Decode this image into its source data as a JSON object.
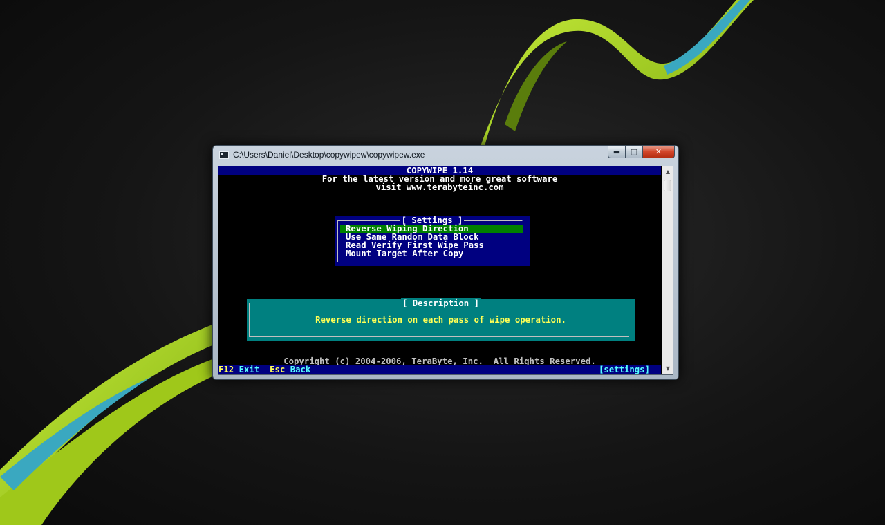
{
  "window": {
    "title": "C:\\Users\\Daniel\\Desktop\\copywipew\\copywipew.exe",
    "minimize_glyph": "▬",
    "maximize_glyph": "□",
    "close_glyph": "✕"
  },
  "console": {
    "header_title": "COPYWIPE 1.14",
    "header_line2": "For the latest version and more great software",
    "header_line3": "visit www.terabyteinc.com",
    "settings": {
      "title": "[ Settings ]",
      "items": [
        {
          "label": "Reverse Wiping Direction",
          "selected": true
        },
        {
          "label": "Use Same Random Data Block",
          "selected": false
        },
        {
          "label": "Read Verify First Wipe Pass",
          "selected": false
        },
        {
          "label": "Mount Target After Copy",
          "selected": false
        }
      ]
    },
    "description": {
      "title": "[ Description ]",
      "text": "Reverse direction on each pass of wipe operation."
    },
    "copyright": "Copyright (c) 2004-2006, TeraByte, Inc.  All Rights Reserved.",
    "footer": {
      "f12_key": "F12",
      "f12_label": "Exit",
      "esc_key": "Esc",
      "esc_label": "Back",
      "context": "[settings]"
    }
  },
  "colors": {
    "console_blue": "#000080",
    "selection_green": "#008000",
    "description_teal": "#008080",
    "highlight_yellow": "#ffff55",
    "footer_cyan": "#55ffff",
    "wallpaper_green": "#a8d41c",
    "wallpaper_teal": "#3aa8c0"
  },
  "icons": [
    "console-app-icon",
    "minimize-icon",
    "maximize-icon",
    "close-icon",
    "scroll-up-arrow-icon",
    "scroll-down-arrow-icon"
  ]
}
